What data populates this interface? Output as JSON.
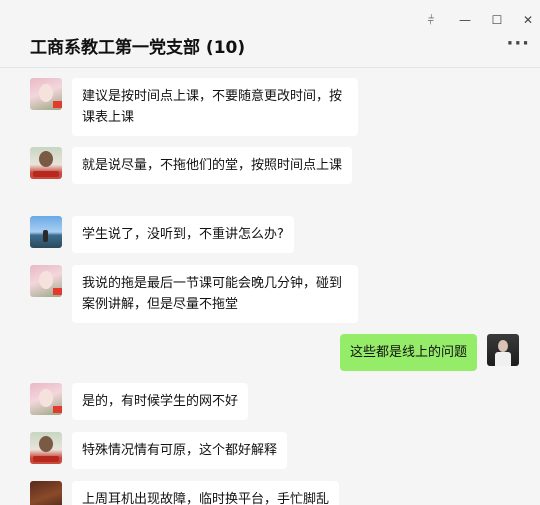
{
  "chat": {
    "title": "工商系教工第一党支部 (10)"
  },
  "window_controls": {
    "pin": "⫩",
    "minimize": "—",
    "maximize": "☐",
    "close": "✕",
    "more": "···"
  },
  "messages": [
    {
      "side": "left",
      "avatar": "a1",
      "text": "建议是按时间点上课，不要随意更改时间，按课表上课"
    },
    {
      "side": "left",
      "avatar": "a2",
      "text": "就是说尽量，不拖他们的堂，按照时间点上课"
    },
    {
      "side": "left",
      "avatar": "a3",
      "text": "学生说了，没听到，不重讲怎么办?"
    },
    {
      "side": "left",
      "avatar": "a1",
      "text": "我说的拖是最后一节课可能会晚几分钟，碰到案例讲解，但是尽量不拖堂"
    },
    {
      "side": "right",
      "avatar": "a4",
      "text": "这些都是线上的问题"
    },
    {
      "side": "left",
      "avatar": "a1",
      "text": "是的，有时候学生的网不好"
    },
    {
      "side": "left",
      "avatar": "a2",
      "text": "特殊情况情有可原，这个都好解释"
    },
    {
      "side": "left",
      "avatar": "a5",
      "text": "上周耳机出现故障，临时换平台，手忙脚乱"
    }
  ]
}
